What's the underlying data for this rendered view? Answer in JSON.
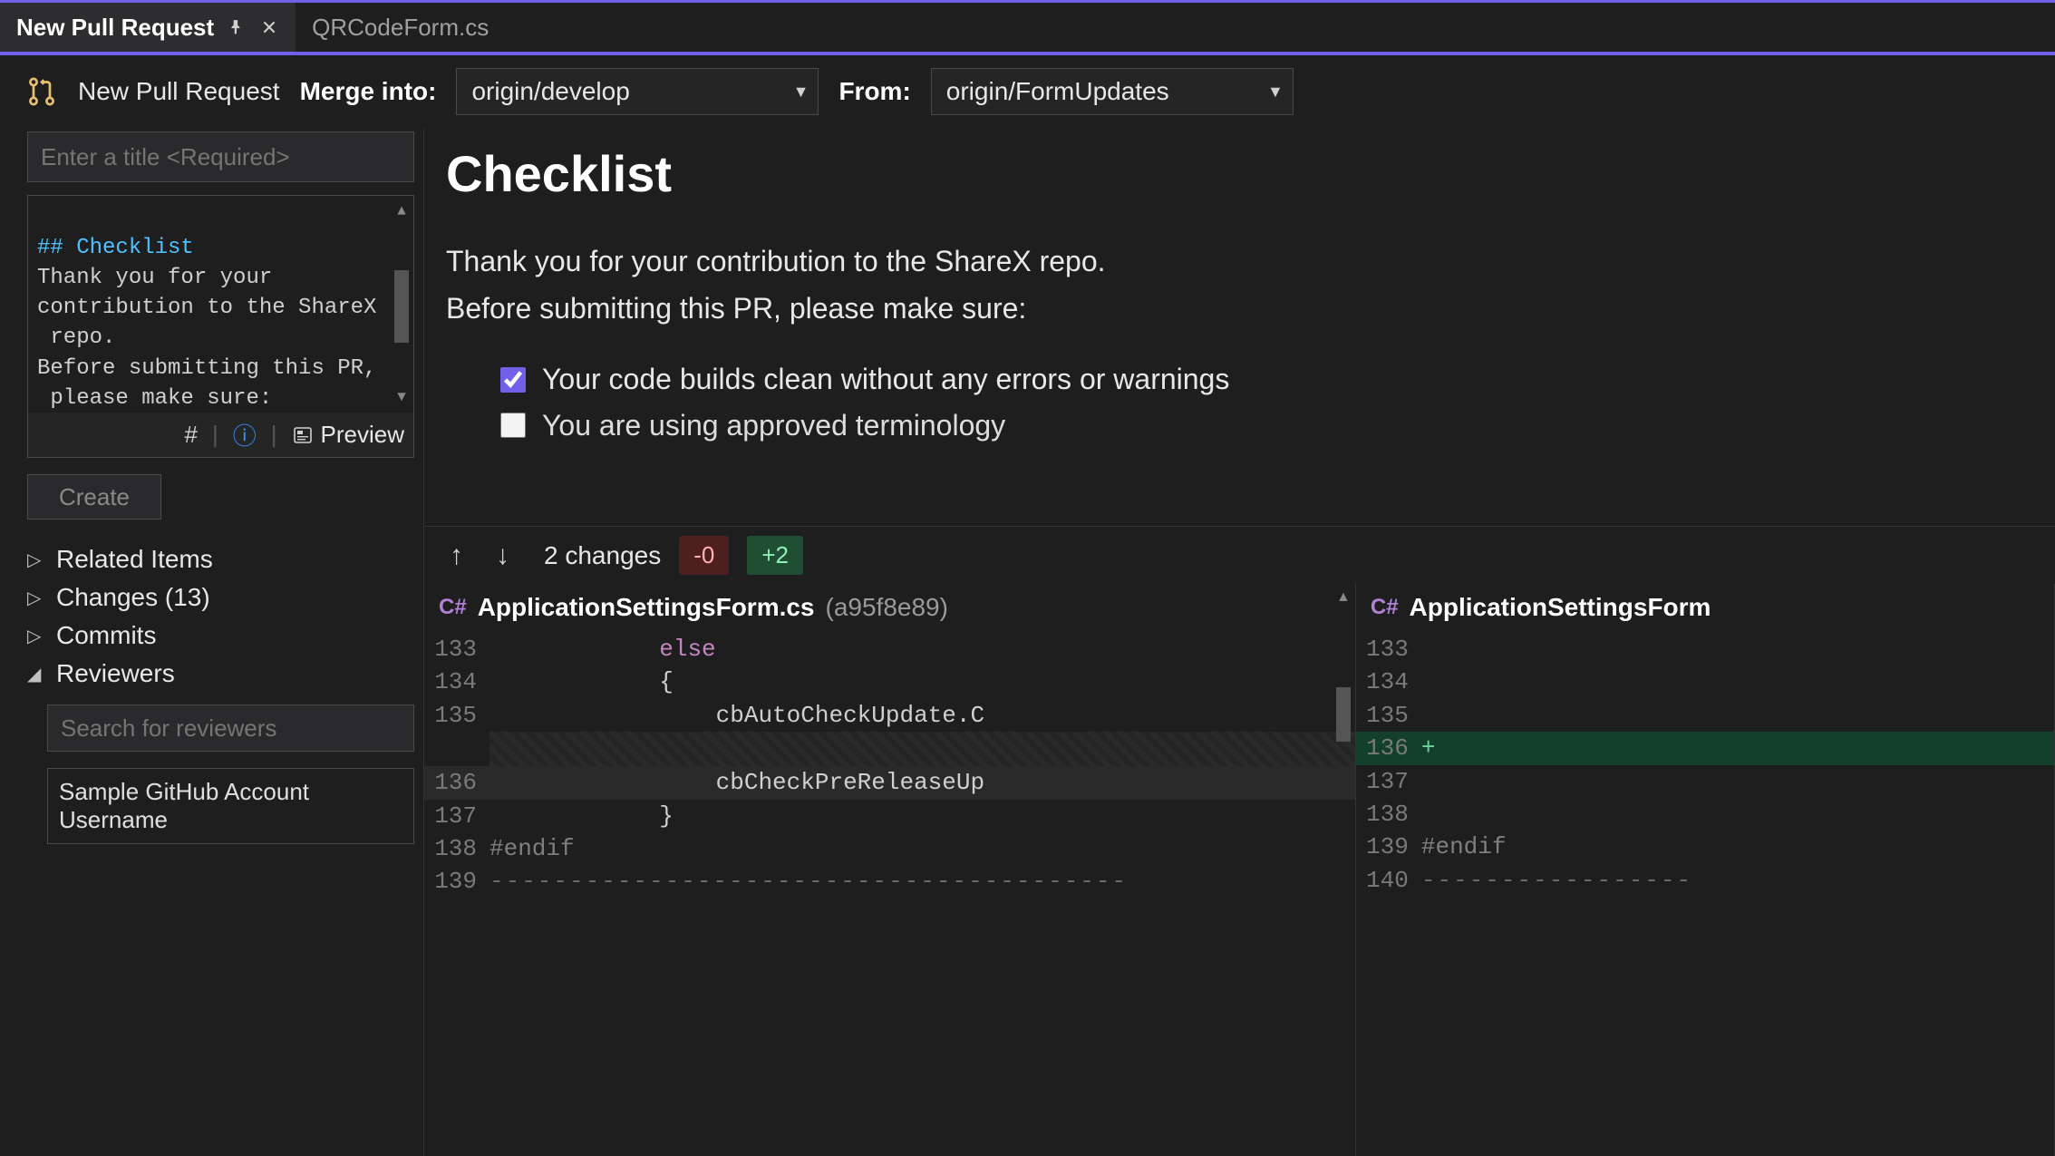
{
  "tabs": {
    "active": "New Pull Request",
    "other": "QRCodeForm.cs"
  },
  "toolbar": {
    "title": "New Pull Request",
    "merge_label": "Merge into:",
    "merge_value": "origin/develop",
    "from_label": "From:",
    "from_value": "origin/FormUpdates"
  },
  "left": {
    "title_placeholder": "Enter a title <Required>",
    "desc_heading": "## Checklist",
    "desc_body": "Thank you for your\ncontribution to the ShareX\n repo.\nBefore submitting this PR,\n please make sure:\n\n- [x] Your code builds",
    "preview_label": "Preview",
    "create_label": "Create",
    "tree": {
      "related": "Related Items",
      "changes": "Changes (13)",
      "commits": "Commits",
      "reviewers": "Reviewers"
    },
    "reviewer_search_placeholder": "Search for reviewers",
    "reviewer_sample": "Sample GitHub Account Username"
  },
  "preview": {
    "heading": "Checklist",
    "p1": "Thank you for your contribution to the ShareX repo.",
    "p2": "Before submitting this PR, please make sure:",
    "check1": "Your code builds clean without any errors or warnings",
    "check2": "You are using approved terminology"
  },
  "diff": {
    "changes_text": "2 changes",
    "minus": "-0",
    "plus": "+2",
    "left_file": "ApplicationSettingsForm.cs",
    "left_hash": "(a95f8e89)",
    "right_file": "ApplicationSettingsForm",
    "left_code": [
      {
        "ln": "133",
        "txt": "            else",
        "cls": "kw"
      },
      {
        "ln": "134",
        "txt": "            {",
        "cls": ""
      },
      {
        "ln": "135",
        "txt": "                cbAutoCheckUpdate.C",
        "cls": ""
      },
      {
        "ln": "",
        "txt": "HATCH",
        "cls": "hatch"
      },
      {
        "ln": "136",
        "txt": "                cbCheckPreReleaseUp",
        "cls": "sel"
      },
      {
        "ln": "137",
        "txt": "            }",
        "cls": ""
      },
      {
        "ln": "138",
        "txt": "#endif",
        "cls": "pre"
      },
      {
        "ln": "139",
        "txt": "----------------------------------------",
        "cls": "dash"
      }
    ],
    "right_code": [
      {
        "ln": "133",
        "txt": "",
        "cls": ""
      },
      {
        "ln": "134",
        "txt": "",
        "cls": ""
      },
      {
        "ln": "135",
        "txt": "",
        "cls": ""
      },
      {
        "ln": "136",
        "txt": "+",
        "cls": "added"
      },
      {
        "ln": "137",
        "txt": "",
        "cls": ""
      },
      {
        "ln": "138",
        "txt": "",
        "cls": ""
      },
      {
        "ln": "139",
        "txt": "#endif",
        "cls": "pre"
      },
      {
        "ln": "140",
        "txt": "-----------------",
        "cls": "dash"
      }
    ]
  }
}
